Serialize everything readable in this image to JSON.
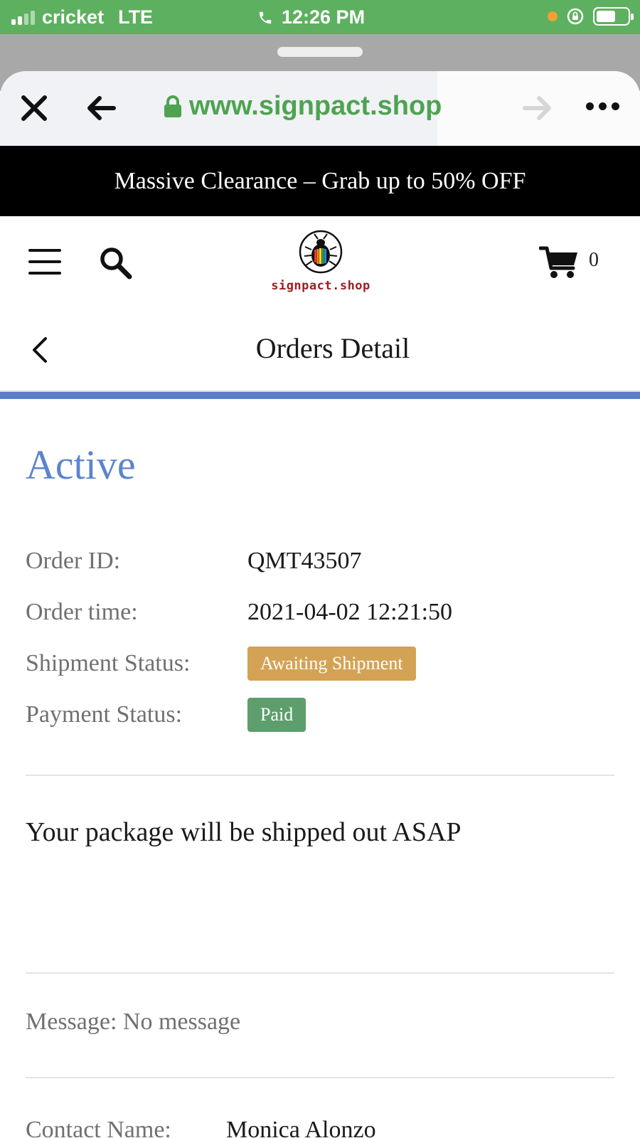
{
  "status_bar": {
    "carrier": "cricket",
    "network": "LTE",
    "time": "12:26 PM"
  },
  "browser": {
    "url": "www.signpact.shop"
  },
  "promo_banner": {
    "text": "Massive Clearance – Grab up to 50% OFF"
  },
  "header": {
    "logo_text": "signpact.shop",
    "cart_count": "0"
  },
  "page": {
    "title": "Orders Detail"
  },
  "order": {
    "status_heading": "Active",
    "rows": [
      {
        "label": "Order ID:",
        "value": "QMT43507"
      },
      {
        "label": "Order time:",
        "value": "2021-04-02 12:21:50"
      },
      {
        "label": "Shipment Status:",
        "value": "Awaiting Shipment"
      },
      {
        "label": "Payment Status:",
        "value": "Paid"
      }
    ],
    "notice": "Your package will be shipped out ASAP",
    "message": "Message: No message",
    "contact_label": "Contact Name:",
    "contact_value": "Monica Alonzo"
  },
  "colors": {
    "status_bar_green": "#5db05f",
    "url_green": "#4ea350",
    "accent_blue": "#5b7ec7",
    "badge_orange": "#d4a254",
    "badge_green": "#5d9e6c"
  },
  "icons": {
    "close": "close-icon",
    "back": "arrow-left-icon",
    "forward": "arrow-right-icon",
    "more": "more-dots-icon",
    "lock": "lock-icon",
    "menu": "menu-icon",
    "search": "search-icon",
    "cart": "cart-icon",
    "chevron": "chevron-left-icon"
  }
}
